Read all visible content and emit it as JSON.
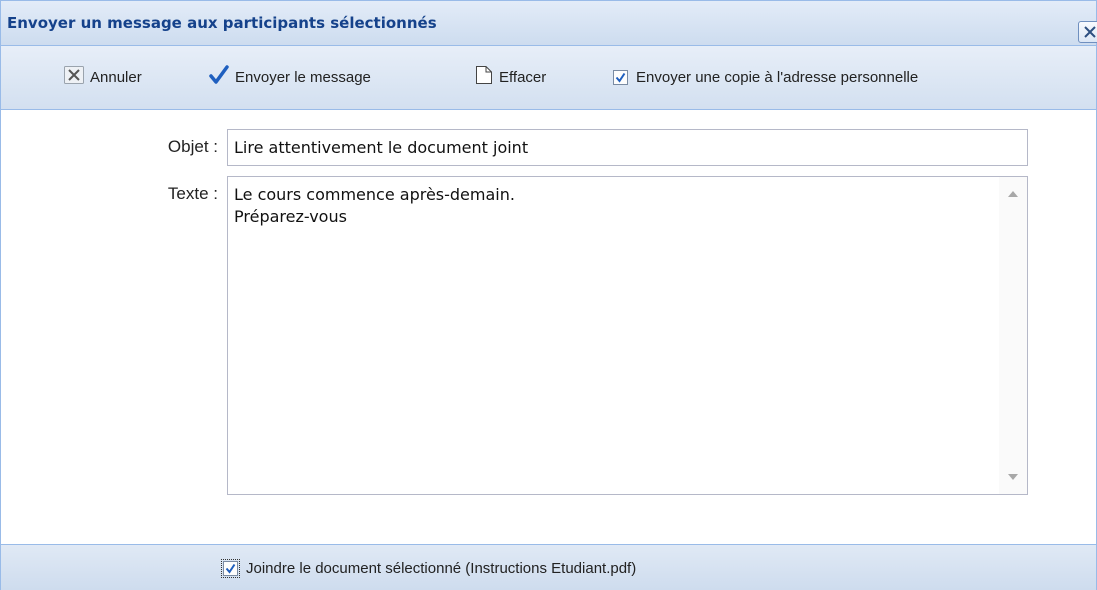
{
  "window": {
    "title": "Envoyer un message aux participants sélectionnés"
  },
  "toolbar": {
    "cancel_label": "Annuler",
    "send_label": "Envoyer le message",
    "clear_label": "Effacer",
    "copy_label": "Envoyer une copie à l'adresse personnelle",
    "copy_checked": true
  },
  "form": {
    "subject_label": "Objet :",
    "subject_value": "Lire attentivement le document joint",
    "text_label": "Texte :",
    "text_value": "Le cours commence après-demain.\nPréparez-vous"
  },
  "footer": {
    "attach_label": "Joindre le document sélectionné (Instructions Etudiant.pdf)",
    "attach_checked": true
  },
  "icons": {
    "close": "close-icon",
    "cancel": "x-icon",
    "send": "checkmark-icon",
    "clear": "blank-document-icon"
  },
  "colors": {
    "title_text": "#15428b",
    "panel_border": "#99bbe8",
    "check_blue": "#1f5fbf"
  }
}
